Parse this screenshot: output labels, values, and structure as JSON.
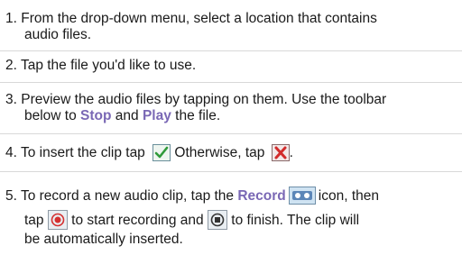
{
  "steps": [
    {
      "l1": "1. From the drop-down menu, select a location that contains",
      "l2": "audio files."
    },
    {
      "l1": "2. Tap the file you'd like to use."
    },
    {
      "l1": "3. Preview the audio files by tapping on them. Use the toolbar",
      "l2a": "below to ",
      "stop": "Stop",
      "and": " and ",
      "play": "Play",
      "l2b": " the file."
    },
    {
      "a": "4. To insert the clip tap ",
      "b": " Otherwise, tap ",
      "c": "."
    },
    {
      "a": "5. To record a new audio clip, tap the ",
      "record": "Record",
      "b": "icon, then",
      "c": "tap ",
      "d": " to start recording and ",
      "e": " to finish. The clip will",
      "f": "be automatically inserted."
    }
  ],
  "icons": {
    "check": "checkmark-icon",
    "cancel": "cancel-x-icon",
    "record": "record-audio-icon",
    "start": "start-record-icon",
    "stop": "stop-record-icon"
  },
  "colors": {
    "keyword": "#7a68b5",
    "text": "#1a1a1a",
    "separator": "#d8d8d8"
  }
}
